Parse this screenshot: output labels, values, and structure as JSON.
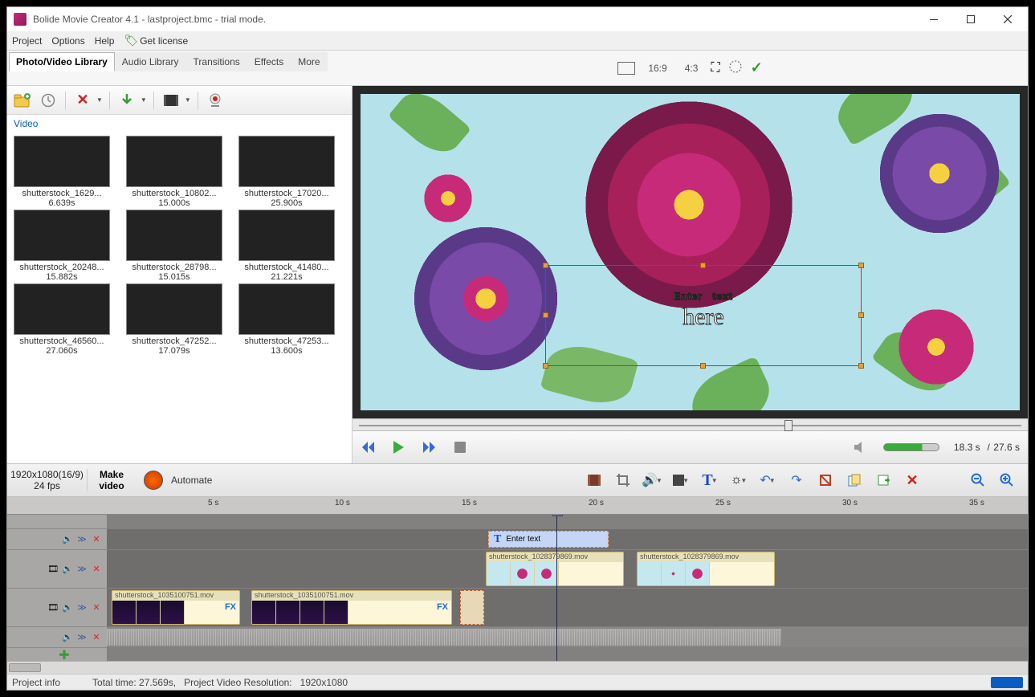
{
  "window": {
    "title": "Bolide Movie Creator 4.1 - lastproject.bmc  - trial mode."
  },
  "menu": {
    "project": "Project",
    "options": "Options",
    "help": "Help",
    "license": "Get license"
  },
  "tabs": {
    "photo": "Photo/Video Library",
    "audio": "Audio Library",
    "trans": "Transitions",
    "effects": "Effects",
    "more": "More"
  },
  "preview": {
    "r169": "16:9",
    "r43": "4:3",
    "time_cur": "18.3 s",
    "time_sep": "/",
    "time_tot": "27.6 s",
    "overlay_line1": "Enter text",
    "overlay_line2": "here"
  },
  "library": {
    "heading": "Video",
    "items": [
      {
        "name": "shutterstock_1629...",
        "dur": "6.639s",
        "art": "art-rose"
      },
      {
        "name": "shutterstock_10802...",
        "dur": "15.000s",
        "art": "art-snow"
      },
      {
        "name": "shutterstock_17020...",
        "dur": "25.900s",
        "art": "art-sunset"
      },
      {
        "name": "shutterstock_20248...",
        "dur": "15.882s",
        "art": "art-arch"
      },
      {
        "name": "shutterstock_28798...",
        "dur": "15.015s",
        "art": "art-rock"
      },
      {
        "name": "shutterstock_41480...",
        "dur": "21.221s",
        "art": "art-tree"
      },
      {
        "name": "shutterstock_46560...",
        "dur": "27.060s",
        "art": "art-wind"
      },
      {
        "name": "shutterstock_47252...",
        "dur": "17.079s",
        "art": "art-wave"
      },
      {
        "name": "shutterstock_47253...",
        "dur": "13.600s",
        "art": "art-mtn"
      }
    ]
  },
  "tlheader": {
    "res": "1920x1080(16/9)",
    "fps": "24 fps",
    "make": "Make video",
    "automate": "Automate"
  },
  "ruler": [
    "5 s",
    "10 s",
    "15 s",
    "20 s",
    "25 s",
    "30 s",
    "35 s"
  ],
  "clips": {
    "text": {
      "label": "Enter text"
    },
    "vid2a": {
      "name": "shutterstock_1028379869.mov"
    },
    "vid2b": {
      "name": "shutterstock_1028379869.mov"
    },
    "vid3a": {
      "name": "shutterstock_1035100751.mov"
    },
    "vid3b": {
      "name": "shutterstock_1035100751.mov"
    },
    "fx": "FX"
  },
  "status": {
    "proj": "Project info",
    "total": "Total time: 27.569s,",
    "reslbl": "Project Video Resolution:",
    "resval": "1920x1080"
  }
}
